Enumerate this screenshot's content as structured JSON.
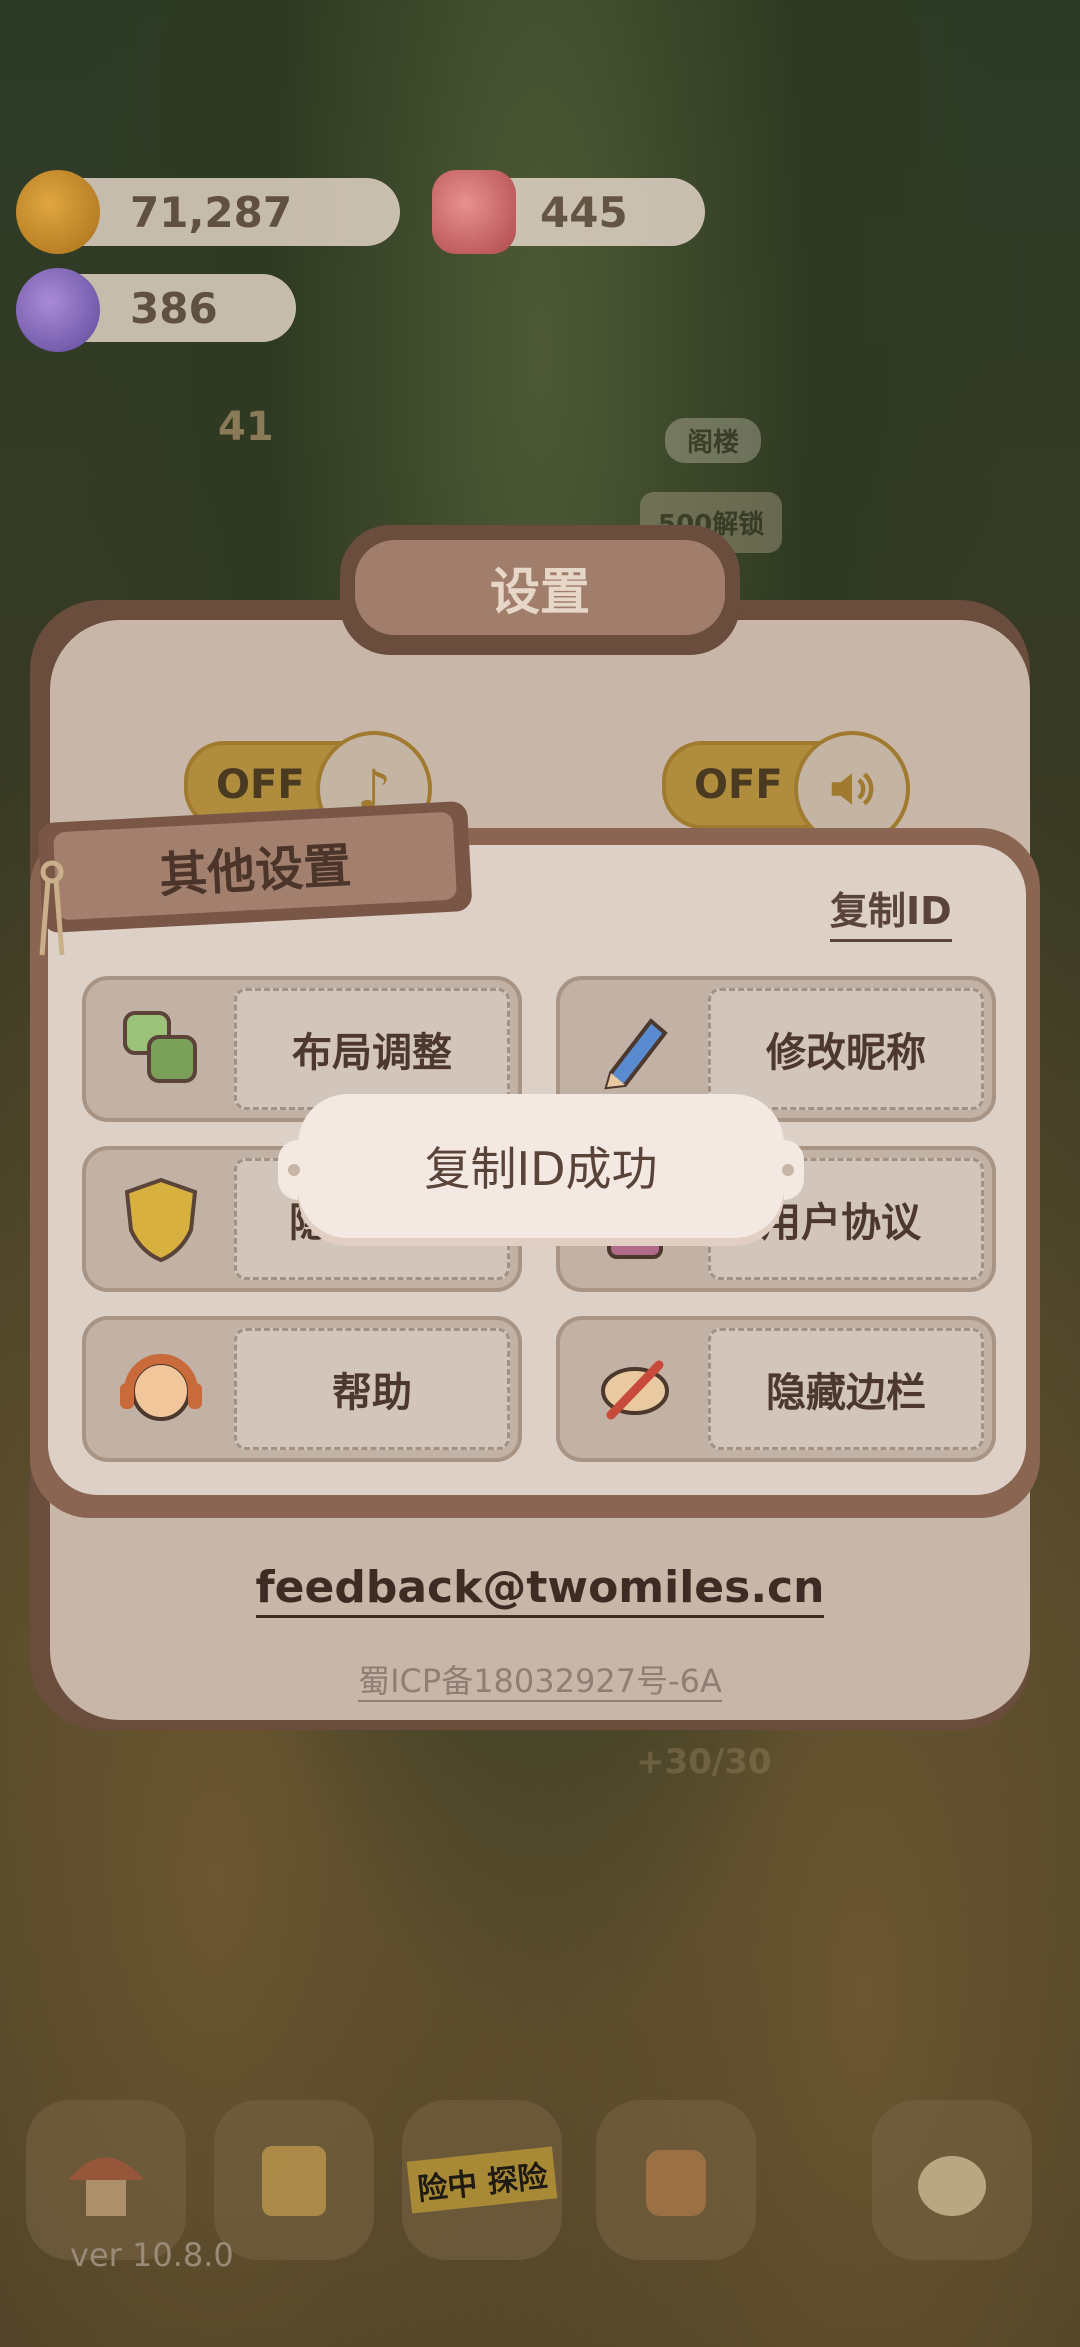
{
  "currency": {
    "coins": "71,287",
    "gems": "445",
    "candies": "386"
  },
  "background": {
    "counter": "41",
    "floor_tag": "阁楼",
    "unlock_cost": "500解锁",
    "energy": "+30/30",
    "adventure_label": "险中 探险"
  },
  "settings": {
    "title": "设置",
    "music_toggle": "OFF",
    "sound_toggle": "OFF",
    "email": "feedback@twomiles.cn",
    "icp": "蜀ICP备18032927号-6A"
  },
  "other_settings": {
    "title": "其他设置",
    "copy_id": "复制ID",
    "options": [
      {
        "label": "布局调整",
        "icon": "layout-icon"
      },
      {
        "label": "修改昵称",
        "icon": "pencil-icon"
      },
      {
        "label": "隐",
        "icon": "shield-icon"
      },
      {
        "label": "用户协议",
        "icon": "document-icon"
      },
      {
        "label": "帮助",
        "icon": "headset-icon"
      },
      {
        "label": "隐藏边栏",
        "icon": "hide-eye-icon"
      }
    ]
  },
  "toast": {
    "message": "复制ID成功"
  },
  "footer": {
    "version": "ver 10.8.0"
  },
  "colors": {
    "panel_brown": "#6b4d3d",
    "panel_cream": "#ddd0c6",
    "toggle_gold": "#b08d3c"
  }
}
